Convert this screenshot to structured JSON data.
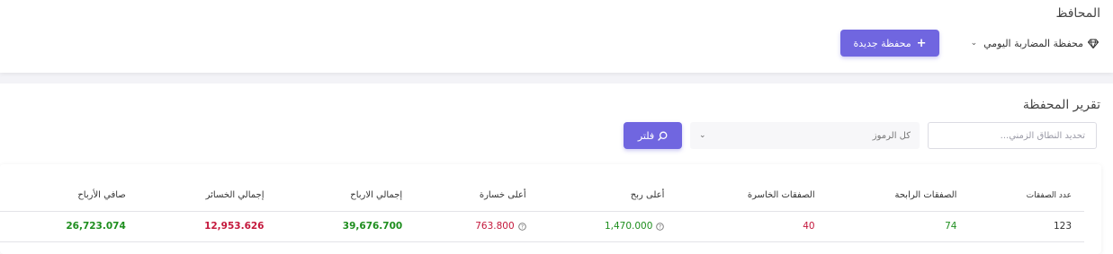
{
  "header": {
    "title": "المحافظ",
    "portfolio_name": "محفظة المضاربة اليومي",
    "new_portfolio_label": "محفظة جديدة"
  },
  "report": {
    "title": "تقرير المحفظة",
    "date_range_placeholder": "تحديد النطاق الزمني...",
    "symbols_label": "كل الرموز",
    "filter_label": "فلتر"
  },
  "table": {
    "headers": [
      "عدد الصفقات",
      "الصفقات الرابحة",
      "الصفقات الخاسرة",
      "أعلى ربح",
      "أعلى خسارة",
      "إجمالي الارباح",
      "إجمالي الخسائر",
      "صافي الأرباح"
    ],
    "row": {
      "trades": "123",
      "winning": "74",
      "losing": "40",
      "max_profit": "1,470.000",
      "max_loss": "763.800",
      "total_profit": "39,676.700",
      "total_loss": "12,953.626",
      "net_profit": "26,723.074"
    }
  },
  "icons": {
    "portfolio": "gem-icon",
    "new": "plus-icon",
    "filter": "search-icon",
    "dropdown": "chevron-down-icon",
    "info": "info-icon"
  },
  "colors": {
    "accent": "#7066e0",
    "positive": "#1e8e1e",
    "negative": "#c4183c"
  }
}
